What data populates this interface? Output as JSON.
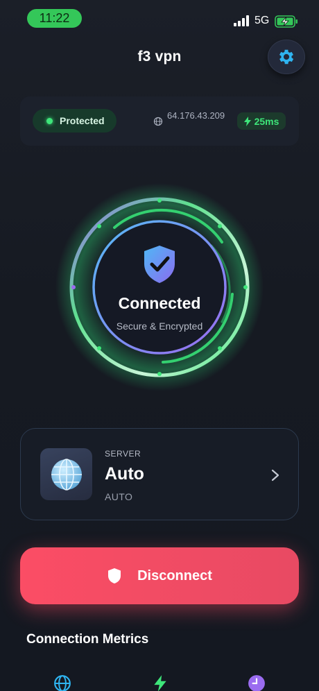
{
  "status_bar": {
    "time": "11:22",
    "network": "5G",
    "icons": [
      "signal-icon",
      "battery-charging-icon"
    ]
  },
  "header": {
    "title": "f3 vpn",
    "settings_icon": "gear-icon"
  },
  "info_bar": {
    "status_label": "Protected",
    "ip_address": "64.176.43.209",
    "latency": "25ms"
  },
  "connection": {
    "status": "Connected",
    "subtitle": "Secure & Encrypted",
    "icon": "shield-check-icon"
  },
  "server": {
    "kicker": "SERVER",
    "name": "Auto",
    "code": "AUTO",
    "icon": "globe-icon"
  },
  "actions": {
    "disconnect_label": "Disconnect"
  },
  "metrics": {
    "title": "Connection Metrics",
    "icons": [
      "globe-icon",
      "bolt-icon",
      "clock-icon"
    ]
  },
  "colors": {
    "accent_green": "#3ee67a",
    "accent_blue": "#2fb4f0",
    "accent_purple": "#9b6cf0",
    "danger": "#fb4d65",
    "background": "#181c25"
  }
}
